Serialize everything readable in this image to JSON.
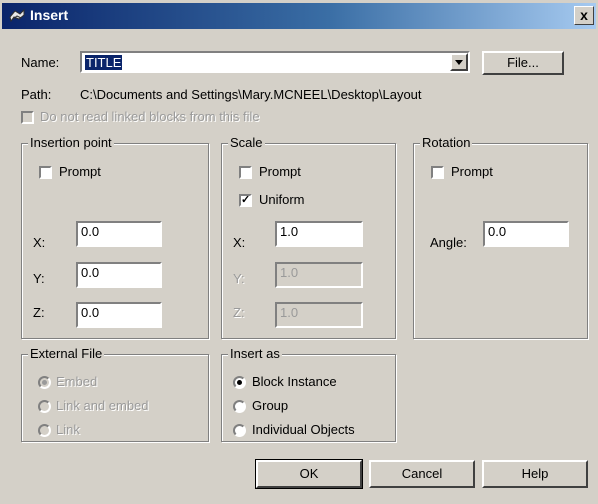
{
  "window": {
    "title": "Insert",
    "close_label": "x"
  },
  "name_row": {
    "label": "Name:",
    "value": "TITLE",
    "file_button": "File..."
  },
  "path_row": {
    "label": "Path:",
    "value": "C:\\Documents and Settings\\Mary.MCNEEL\\Desktop\\Layout"
  },
  "linked_blocks": {
    "label": "Do not read linked blocks from this file",
    "checked": false,
    "enabled": false
  },
  "insertion_point": {
    "title": "Insertion point",
    "prompt_label": "Prompt",
    "x_label": "X:",
    "x_value": "0.0",
    "y_label": "Y:",
    "y_value": "0.0",
    "z_label": "Z:",
    "z_value": "0.0"
  },
  "scale": {
    "title": "Scale",
    "prompt_label": "Prompt",
    "uniform_label": "Uniform",
    "uniform_checked": true,
    "x_label": "X:",
    "x_value": "1.0",
    "y_label": "Y:",
    "y_value": "1.0",
    "z_label": "Z:",
    "z_value": "1.0"
  },
  "rotation": {
    "title": "Rotation",
    "prompt_label": "Prompt",
    "angle_label": "Angle:",
    "angle_value": "0.0"
  },
  "external_file": {
    "title": "External File",
    "options": [
      "Embed",
      "Link and embed",
      "Link"
    ],
    "selected": "Embed"
  },
  "insert_as": {
    "title": "Insert as",
    "options": [
      "Block Instance",
      "Group",
      "Individual Objects"
    ],
    "selected": "Block Instance"
  },
  "buttons": {
    "ok": "OK",
    "cancel": "Cancel",
    "help": "Help"
  },
  "colors": {
    "dialog_bg": "#d4d0c8",
    "title_start": "#0a246a",
    "title_end": "#a6caf0",
    "selection": "#0a246a"
  },
  "icons": {
    "app": "insert-block-icon",
    "combo": "chevron-down-icon"
  }
}
